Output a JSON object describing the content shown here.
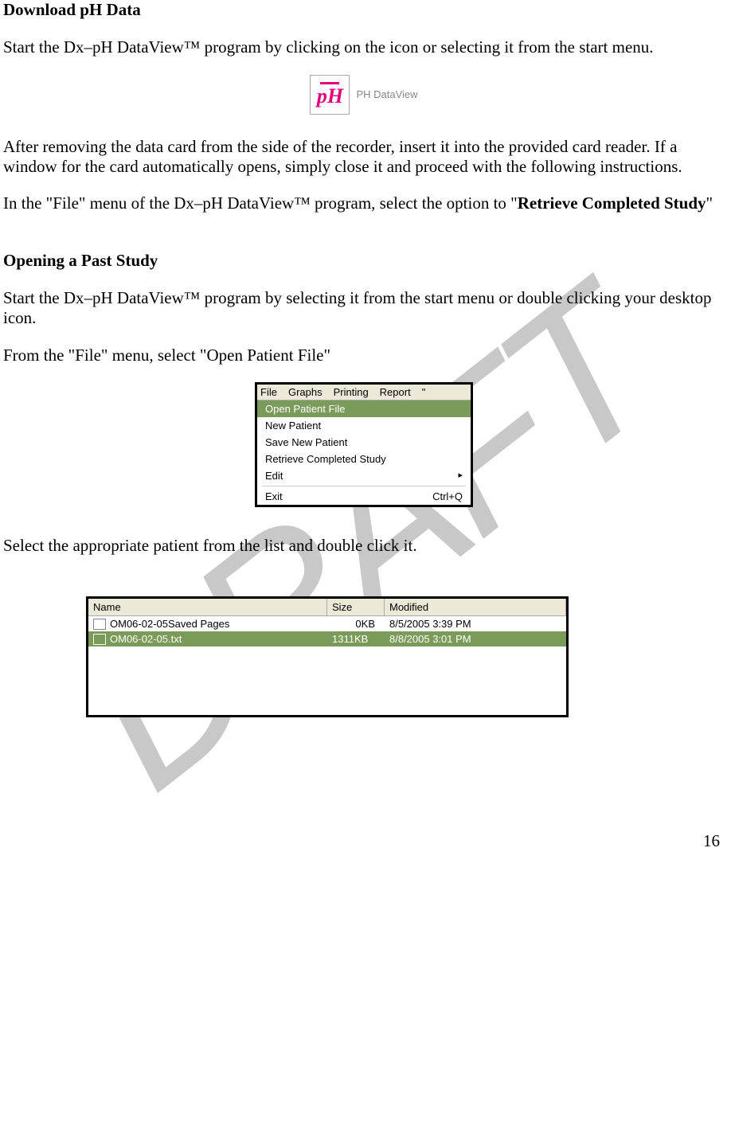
{
  "watermark": "DRAFT",
  "page_number": "16",
  "section1": {
    "heading": "Download pH Data",
    "para1": "Start the Dx–pH DataView™ program by clicking on the icon or selecting it from the start menu.",
    "logo_text": "pH",
    "logo_label": "PH DataView",
    "para2": "After removing the data card from the side of the recorder, insert it into the provided card reader.  If a window for the card automatically opens, simply close it and proceed with the following instructions.",
    "para3_a": "In the \"File\" menu of the Dx–pH DataView™ program, select the option to \"",
    "para3_b": "Retrieve Completed Study",
    "para3_c": "\""
  },
  "section2": {
    "heading": "Opening a Past Study",
    "para1": "Start the Dx–pH DataView™ program by selecting it from the start menu or double clicking your desktop icon.",
    "para2": "From the \"File\" menu, select \"Open Patient File\"",
    "para3": "Select the appropriate patient from the list and double click it."
  },
  "menu": {
    "bar": [
      "File",
      "Graphs",
      "Printing",
      "Report"
    ],
    "tail": "\"",
    "items": [
      {
        "label": "Open Patient File",
        "hl": true
      },
      {
        "label": "New Patient"
      },
      {
        "label": "Save New Patient"
      },
      {
        "label": "Retrieve Completed Study"
      },
      {
        "label": "Edit",
        "arrow": "▸"
      }
    ],
    "exit": {
      "label": "Exit",
      "shortcut": "Ctrl+Q"
    }
  },
  "filelist": {
    "headers": {
      "name": "Name",
      "size": "Size",
      "modified": "Modified"
    },
    "rows": [
      {
        "icon": "folder",
        "name": "OM06-02-05Saved Pages",
        "size": "0KB",
        "modified": "8/5/2005 3:39 PM",
        "sel": false
      },
      {
        "icon": "file",
        "name": "OM06-02-05.txt",
        "size": "1311KB",
        "modified": "8/8/2005 3:01 PM",
        "sel": true
      }
    ]
  }
}
